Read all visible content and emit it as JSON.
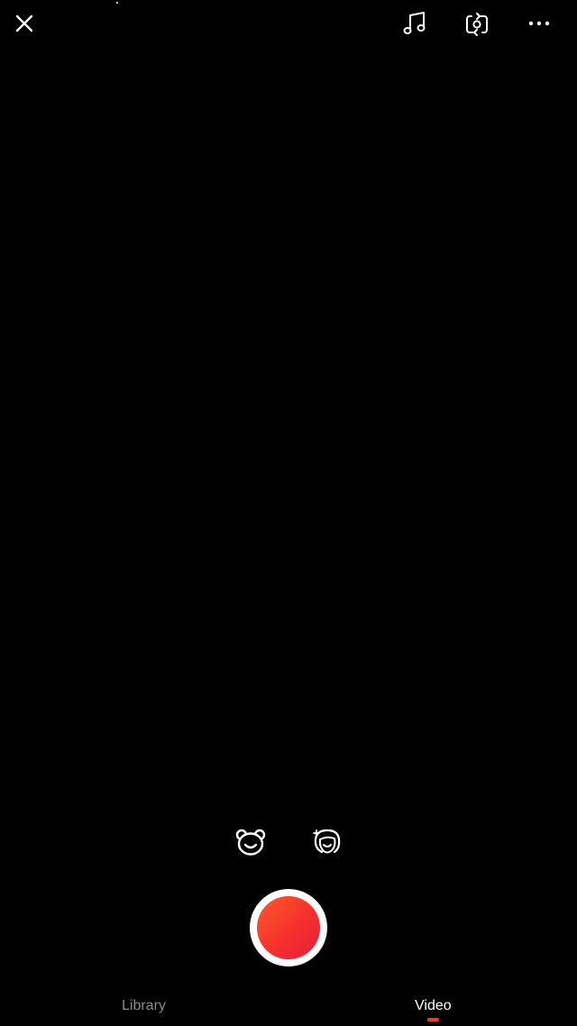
{
  "top_bar": {
    "close_icon": "close-icon",
    "music_icon": "music-note-icon",
    "flip_icon": "camera-flip-icon",
    "more_icon": "more-horizontal-icon"
  },
  "effects": {
    "sticker_icon": "bear-sticker-icon",
    "beauty_icon": "beauty-face-icon"
  },
  "record": {
    "icon": "record-button",
    "accent_color": "#f5302e"
  },
  "modes": {
    "tabs": [
      {
        "label": "Library",
        "active": false
      },
      {
        "label": "Video",
        "active": true
      }
    ],
    "active_color": "#ffffff",
    "inactive_color": "#8a8a8a",
    "indicator_color": "#f03a2e"
  }
}
